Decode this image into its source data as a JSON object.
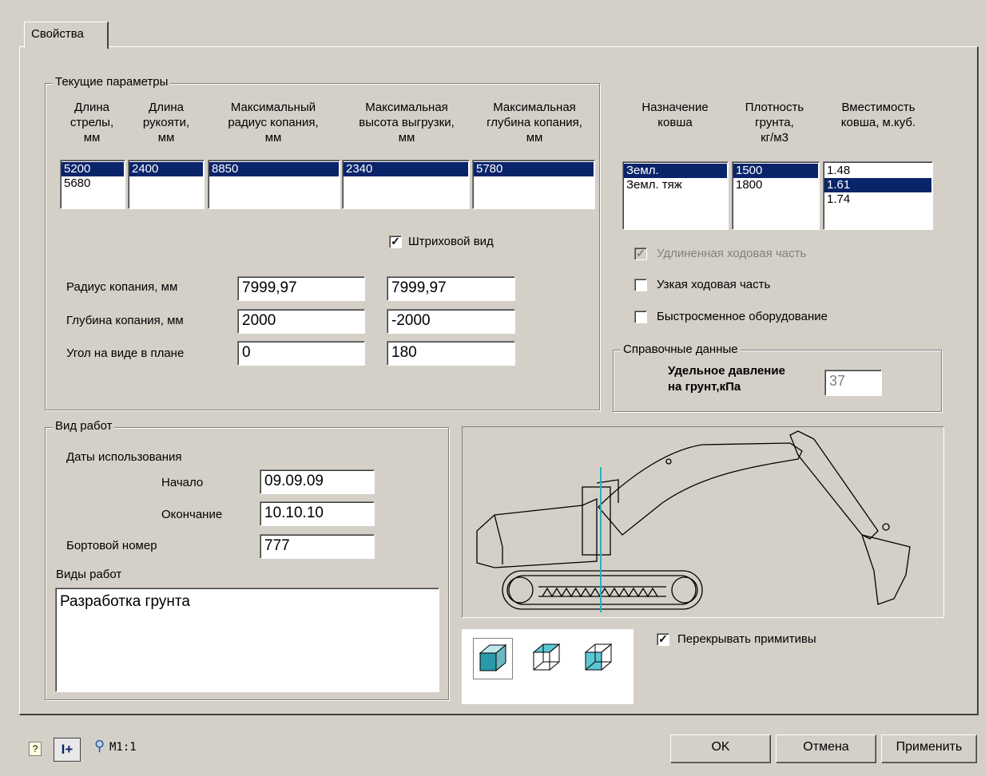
{
  "tab": {
    "label": "Свойства"
  },
  "current_params": {
    "legend": "Текущие параметры",
    "columns": [
      {
        "header": [
          "Длина",
          "стрелы,",
          "мм"
        ],
        "items": [
          "5200",
          "5680"
        ],
        "selected": 0
      },
      {
        "header": [
          "Длина",
          "рукояти,",
          "мм"
        ],
        "items": [
          "2400"
        ],
        "selected": 0
      },
      {
        "header": [
          "Максимальный",
          "радиус копания,",
          "мм"
        ],
        "items": [
          "8850"
        ],
        "selected": 0
      },
      {
        "header": [
          "Максимальная",
          "высота выгрузки,",
          "мм"
        ],
        "items": [
          "2340"
        ],
        "selected": 0
      },
      {
        "header": [
          "Максимальная",
          "глубина копания,",
          "мм"
        ],
        "items": [
          "5780"
        ],
        "selected": 0
      }
    ],
    "hatch_view": {
      "label": "Штриховой вид",
      "checked": true
    },
    "fields": {
      "dig_radius": {
        "label": "Радиус копания, мм",
        "value1": "7999,97",
        "value2": "7999,97"
      },
      "dig_depth": {
        "label": "Глубина копания, мм",
        "value1": "2000",
        "value2": "-2000"
      },
      "plan_angle": {
        "label": "Угол на виде в плане",
        "value1": "0",
        "value2": "180"
      }
    }
  },
  "bucket": {
    "columns": [
      {
        "header": [
          "Назначение",
          "ковша"
        ],
        "items": [
          "Земл.",
          "Земл. тяж"
        ],
        "selected": 0
      },
      {
        "header": [
          "Плотность",
          "грунта,",
          "кг/м3"
        ],
        "items": [
          "1500",
          "1800"
        ],
        "selected": 0
      },
      {
        "header": [
          "Вместимость",
          "ковша, м.куб."
        ],
        "items": [
          "1.48",
          "1.61",
          "1.74"
        ],
        "selected": 1
      }
    ],
    "options": {
      "extended_undercarriage": {
        "label": "Удлиненная ходовая часть",
        "checked": true,
        "disabled": true
      },
      "narrow_undercarriage": {
        "label": "Узкая ходовая часть",
        "checked": false
      },
      "quick_change": {
        "label": "Быстросменное оборудование",
        "checked": false
      }
    }
  },
  "reference": {
    "legend": "Справочные данные",
    "pressure_label": [
      "Удельное давление",
      "на грунт,кПа"
    ],
    "pressure_value": "37"
  },
  "work": {
    "legend": "Вид работ",
    "dates_label": "Даты использования",
    "start_label": "Начало",
    "start_value": "09.09.09",
    "end_label": "Окончание",
    "end_value": "10.10.10",
    "board_label": "Бортовой номер",
    "board_value": "777",
    "types_label": "Виды работ",
    "types_value": "Разработка грунта"
  },
  "overlap": {
    "label": "Перекрывать примитивы",
    "checked": true
  },
  "bottom": {
    "scale": "M1:1",
    "ok": "OK",
    "cancel": "Отмена",
    "apply": "Применить"
  }
}
